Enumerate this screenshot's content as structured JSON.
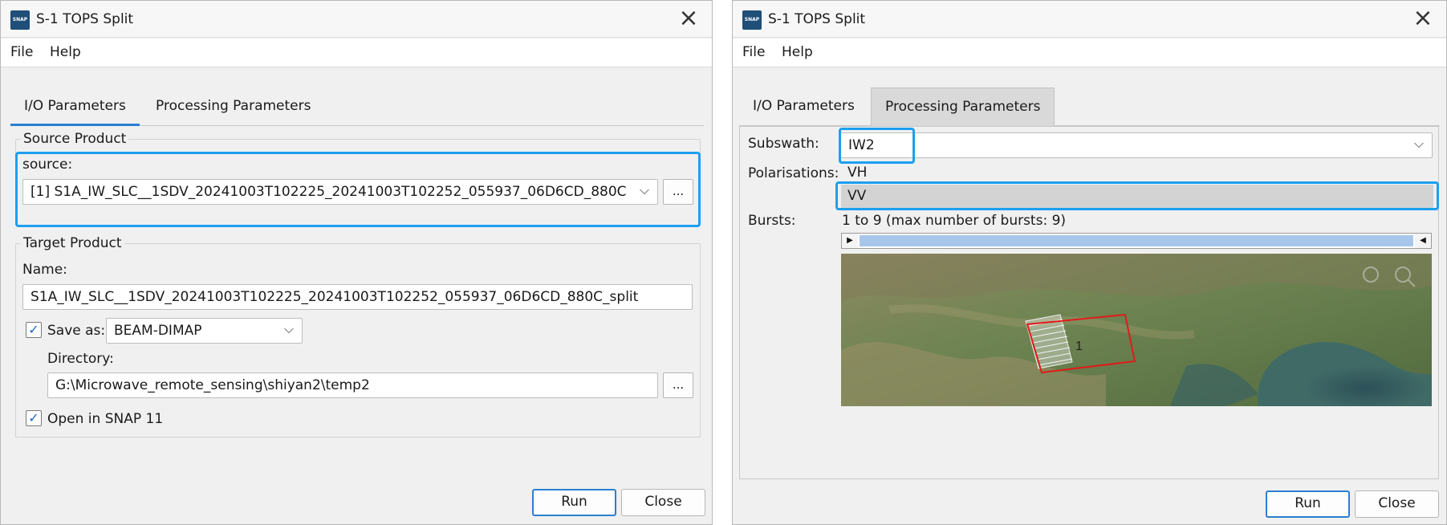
{
  "left_window": {
    "title": "S-1 TOPS Split",
    "menu": [
      "File",
      "Help"
    ],
    "tabs": [
      "I/O Parameters",
      "Processing Parameters"
    ],
    "source_group_title": "Source Product",
    "source_label": "source:",
    "source_value": "[1] S1A_IW_SLC__1SDV_20241003T102225_20241003T102252_055937_06D6CD_880C",
    "ellipsis": "...",
    "target_group_title": "Target Product",
    "name_label": "Name:",
    "name_value": "S1A_IW_SLC__1SDV_20241003T102225_20241003T102252_055937_06D6CD_880C_split",
    "save_as_label": "Save as:",
    "save_as_checked": true,
    "save_format": "BEAM-DIMAP",
    "directory_label": "Directory:",
    "directory_value": "G:\\Microwave_remote_sensing\\shiyan2\\temp2",
    "open_in_snap_label": "Open in SNAP 11",
    "open_in_snap_checked": true,
    "run_label": "Run",
    "close_label": "Close"
  },
  "right_window": {
    "title": "S-1 TOPS Split",
    "menu": [
      "File",
      "Help"
    ],
    "tabs": [
      "I/O Parameters",
      "Processing Parameters"
    ],
    "subswath_label": "Subswath:",
    "subswath_value": "IW2",
    "polarisations_label": "Polarisations:",
    "polarisations": [
      "VH",
      "VV"
    ],
    "selected_polarisation": "VV",
    "bursts_label": "Bursts:",
    "bursts_value": "1 to 9 (max number of bursts: 9)",
    "burst_number": "1",
    "run_label": "Run",
    "close_label": "Close"
  },
  "colors": {
    "highlight": "#1c9ff0",
    "accent": "#2a7fd1",
    "burst_outline": "#e01b1b"
  },
  "icons": [
    "snap-app-icon",
    "close-icon",
    "chevron-down-icon",
    "checkmark-icon",
    "arrow-left-icon",
    "arrow-right-icon",
    "zoom-icon"
  ]
}
